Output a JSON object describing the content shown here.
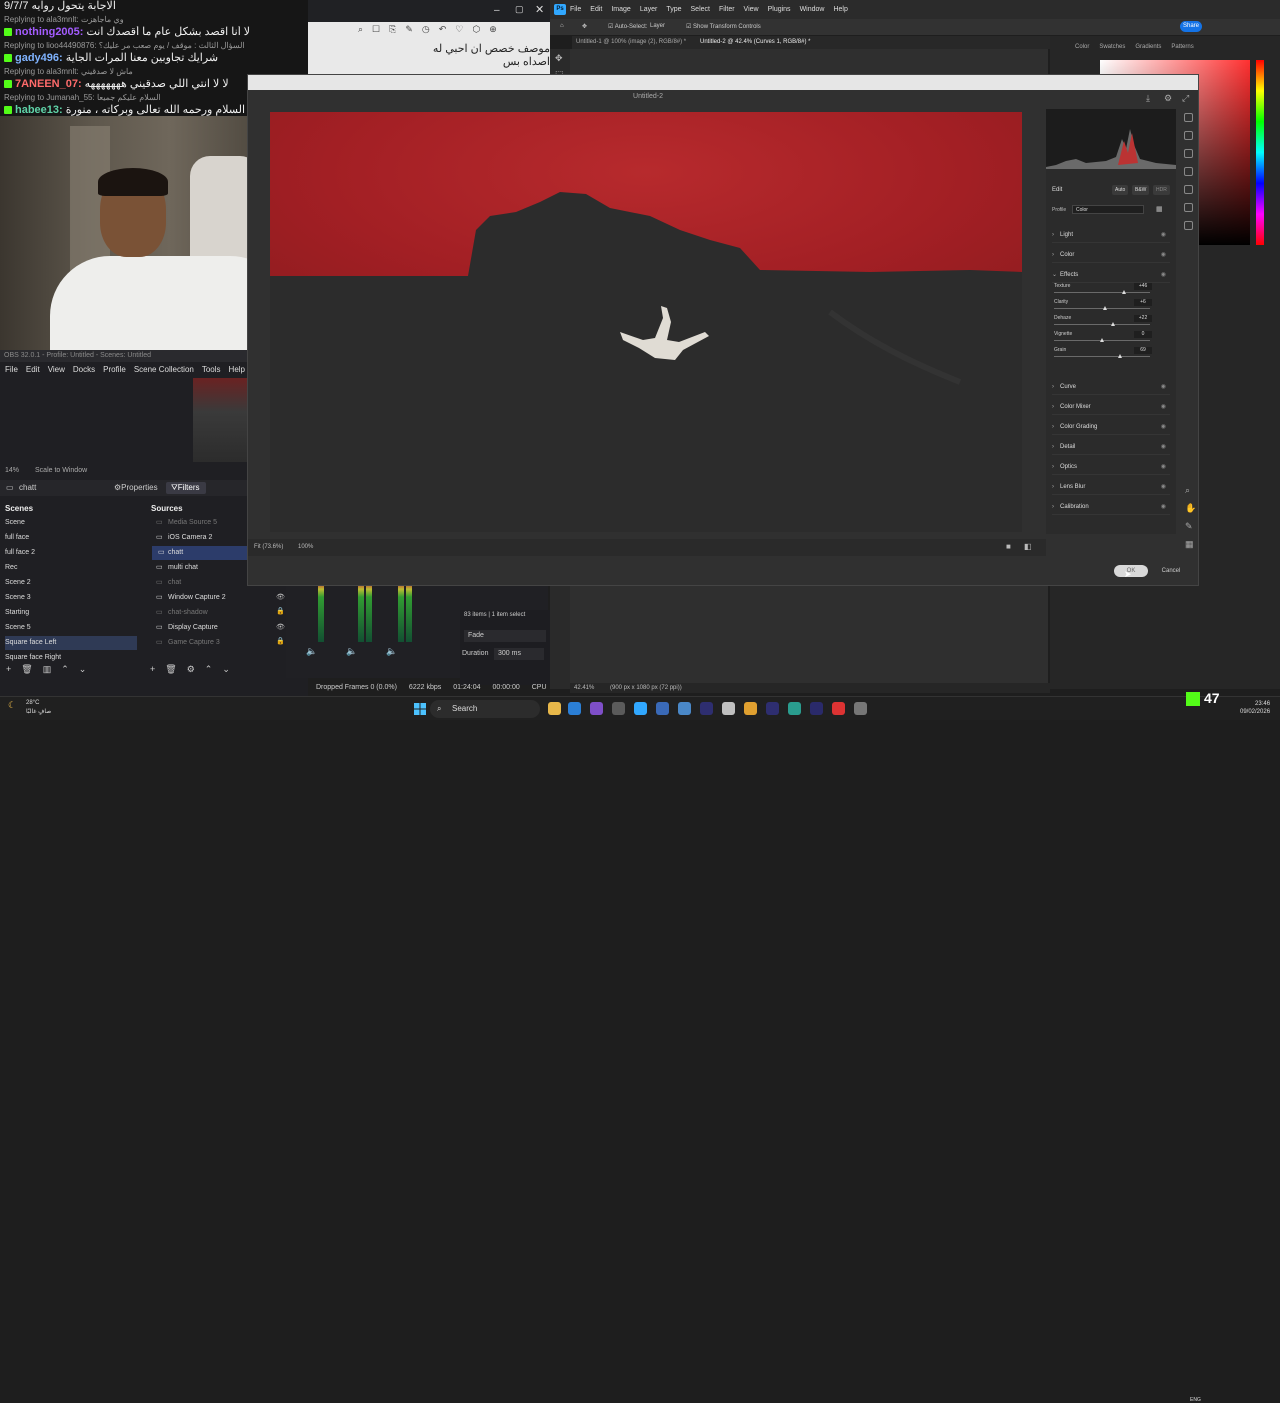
{
  "chat": {
    "lines": [
      {
        "kind": "msg",
        "user": "",
        "text": "الاجابة يتحول روايه 9/7/7",
        "color": "#ffffff"
      },
      {
        "kind": "reply",
        "user": "",
        "text": "Replying to ala3mnlt: وي ماجاهزت"
      },
      {
        "kind": "msg",
        "user": "nothing2005:",
        "text": "لا أنا اقصد بشكل عام ما أقصدك انت",
        "color": "#a45cff"
      },
      {
        "kind": "reply",
        "user": "",
        "text": "Replying to lioo44490876: السؤال الثالث : موقف / يوم صعب مر عليك؟"
      },
      {
        "kind": "msg",
        "user": "gady496:",
        "text": "شرايك تجاوبين معنا المرات الجاية",
        "color": "#7fb3ff"
      },
      {
        "kind": "reply",
        "user": "",
        "text": "Replying to ala3mnlt: ماش لا صدقيني"
      },
      {
        "kind": "msg",
        "user": "7ANEEN_07:",
        "text": "لا لا انتي اللي صدقيني هههههههه",
        "color": "#ff6b6b"
      },
      {
        "kind": "reply",
        "user": "",
        "text": "Replying to Jumanah_55: السلام عليكم جميعا"
      },
      {
        "kind": "msg",
        "user": "habee13:",
        "text": "وعليكم السلام ورحمه الله تعالى وبركاته ، منورة",
        "color": "#5fd3a8"
      }
    ]
  },
  "obs": {
    "title": "OBS 32.0.1 - Profile: Untitled - Scenes: Untitled",
    "menu": [
      "File",
      "Edit",
      "View",
      "Docks",
      "Profile",
      "Scene Collection",
      "Tools",
      "Help"
    ],
    "zoom_label": "14%",
    "scale_label": "Scale to Window",
    "selected_source": "chatt",
    "properties_label": "Properties",
    "filters_label": "Filters",
    "scenes_header": "Scenes",
    "sources_header": "Sources",
    "scenes": [
      "Scene",
      "full face",
      "full face 2",
      "Rec",
      "Scene 2",
      "Scene 3",
      "Starting",
      "Scene 5",
      "Square face Left",
      "Square face Right"
    ],
    "selected_scene_index": 8,
    "sources": [
      {
        "name": "Media Source 5",
        "dim": true
      },
      {
        "name": "iOS Camera 2",
        "dim": false
      },
      {
        "name": "chatt",
        "dim": false,
        "selected": true
      },
      {
        "name": "multi chat",
        "dim": false
      },
      {
        "name": "chat",
        "dim": true
      },
      {
        "name": "Window Capture 2",
        "dim": false
      },
      {
        "name": "chat-shadow",
        "dim": true
      },
      {
        "name": "Display Capture",
        "dim": false
      },
      {
        "name": "Game Capture 3",
        "dim": true
      }
    ],
    "transition_label": "Fade",
    "duration_label": "Duration",
    "duration_value": "300 ms",
    "items_count": "83 items",
    "items_selected": "1 item select",
    "status": {
      "dropped": "Dropped Frames 0 (0.0%)",
      "kbps": "6222 kbps",
      "stream_time": "01:24:04",
      "rec_time": "00:00:00",
      "cpu": "CPU"
    }
  },
  "browser": {
    "text": "موصف خصص ان احبي له اصداه بس"
  },
  "photoshop": {
    "logo": "Ps",
    "menu": [
      "File",
      "Edit",
      "Image",
      "Layer",
      "Type",
      "Select",
      "Filter",
      "View",
      "Plugins",
      "Window",
      "Help"
    ],
    "options": {
      "auto_select": "Auto-Select:",
      "layer": "Layer",
      "transform": "Show Transform Controls"
    },
    "share_label": "Share",
    "tabs": [
      "Untitled-1 @ 100% (image (2), RGB/8#) *",
      "Untitled-2 @ 42.4% (Curves 1, RGB/8#) *"
    ],
    "color_tabs": [
      "Color",
      "Swatches",
      "Gradients",
      "Patterns"
    ],
    "status_zoom": "42.41%",
    "status_doc": "(900 px x 1080 px (72 ppi))"
  },
  "camera_raw": {
    "title": "Untitled-2",
    "edit_label": "Edit",
    "auto_label": "Auto",
    "bw_label": "B&W",
    "hdr_label": "HDR",
    "profile_label": "Profile",
    "profile_value": "Color",
    "sections": [
      {
        "name": "Light",
        "open": false
      },
      {
        "name": "Color",
        "open": false
      },
      {
        "name": "Effects",
        "open": true
      },
      {
        "name": "Curve",
        "open": false
      },
      {
        "name": "Color Mixer",
        "open": false
      },
      {
        "name": "Color Grading",
        "open": false
      },
      {
        "name": "Detail",
        "open": false
      },
      {
        "name": "Optics",
        "open": false
      },
      {
        "name": "Lens Blur",
        "open": false
      },
      {
        "name": "Calibration",
        "open": false
      }
    ],
    "effects": [
      {
        "label": "Texture",
        "value": "+46",
        "fraction": 0.73
      },
      {
        "label": "Clarity",
        "value": "+6",
        "fraction": 0.53
      },
      {
        "label": "Dehaze",
        "value": "+22",
        "fraction": 0.61
      },
      {
        "label": "Vignette",
        "value": "0",
        "fraction": 0.5
      },
      {
        "label": "Grain",
        "value": "69",
        "fraction": 0.69
      }
    ],
    "fit_label": "Fit (73.6%)",
    "zoom_label": "100%",
    "ok_label": "OK",
    "cancel_label": "Cancel"
  },
  "taskbar": {
    "weather_temp": "28°C",
    "weather_desc": "صافٍ غالبًا",
    "search_label": "Search",
    "lang": "ENG",
    "time": "23:46",
    "date": "09/02/2026",
    "kick_count": "47"
  }
}
